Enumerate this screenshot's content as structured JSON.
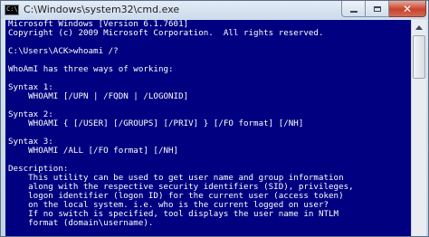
{
  "window": {
    "title": "C:\\Windows\\system32\\cmd.exe",
    "icon": "cmd-prompt-icon",
    "icon_text": "C:\\_"
  },
  "controls": {
    "minimize_icon": "minimize-icon",
    "maximize_icon": "maximize-icon",
    "close_icon": "close-icon",
    "close_glyph": "✕"
  },
  "scrollbar": {
    "up_arrow_icon": "arrow-up-icon"
  },
  "colors": {
    "console_background": "#000080",
    "console_text": "#ffffff",
    "close_button": "#c7432d"
  },
  "console": {
    "lines": [
      "Microsoft Windows [Version 6.1.7601]",
      "Copyright (c) 2009 Microsoft Corporation.  All rights reserved.",
      "",
      "C:\\Users\\ACK>whoami /?",
      "",
      "WhoAmI has three ways of working:",
      "",
      "Syntax 1:",
      "    WHOAMI [/UPN | /FQDN | /LOGONID]",
      "",
      "Syntax 2:",
      "    WHOAMI { [/USER] [/GROUPS] [/PRIV] } [/FO format] [/NH]",
      "",
      "Syntax 3:",
      "    WHOAMI /ALL [/FO format] [/NH]",
      "",
      "Description:",
      "    This utility can be used to get user name and group information",
      "    along with the respective security identifiers (SID), privileges,",
      "    logon identifier (logon ID) for the current user (access token)",
      "    on the local system. i.e. who is the current logged on user?",
      "    If no switch is specified, tool displays the user name in NTLM",
      "    format (domain\\username)."
    ]
  }
}
